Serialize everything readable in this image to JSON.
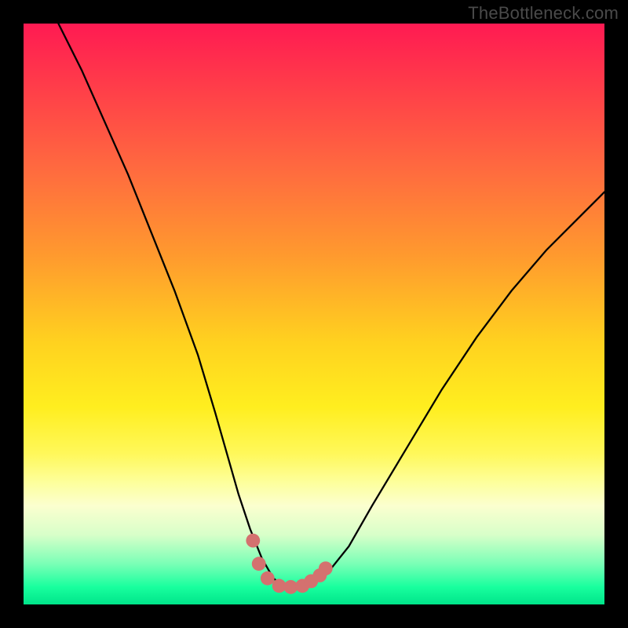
{
  "watermark": "TheBottleneck.com",
  "chart_data": {
    "type": "line",
    "title": "",
    "xlabel": "",
    "ylabel": "",
    "xlim": [
      0,
      100
    ],
    "ylim": [
      0,
      100
    ],
    "series": [
      {
        "name": "bottleneck-curve",
        "x": [
          6,
          10,
          14,
          18,
          22,
          26,
          30,
          33,
          35,
          37,
          39,
          41,
          43,
          45,
          47,
          49,
          52,
          56,
          60,
          66,
          72,
          78,
          84,
          90,
          96,
          100
        ],
        "values": [
          100,
          92,
          83,
          74,
          64,
          54,
          43,
          33,
          26,
          19,
          13,
          8,
          4.5,
          3,
          3,
          3.5,
          5,
          10,
          17,
          27,
          37,
          46,
          54,
          61,
          67,
          71
        ]
      }
    ],
    "markers": {
      "name": "trough-markers",
      "color": "#d4716f",
      "radius_pct": 1.2,
      "points": [
        {
          "x": 39.5,
          "y": 11
        },
        {
          "x": 40.5,
          "y": 7
        },
        {
          "x": 42,
          "y": 4.5
        },
        {
          "x": 44,
          "y": 3.2
        },
        {
          "x": 46,
          "y": 3
        },
        {
          "x": 48,
          "y": 3.2
        },
        {
          "x": 49.5,
          "y": 4
        },
        {
          "x": 51,
          "y": 5
        },
        {
          "x": 52,
          "y": 6.2
        }
      ]
    },
    "background_gradient": {
      "top": "#ff1a52",
      "upper_mid": "#ff9a2e",
      "mid": "#ffee1f",
      "lower_mid": "#d8ffc9",
      "bottom": "#00e58a"
    }
  }
}
